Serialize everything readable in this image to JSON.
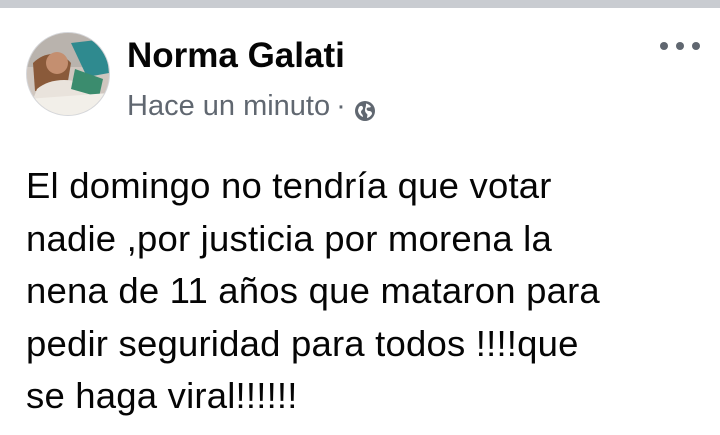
{
  "post": {
    "author_name": "Norma Galati",
    "timestamp": "Hace un minuto",
    "separator": "·",
    "privacy_icon": "globe-icon",
    "more_icon": "more-options-icon",
    "text_lines": [
      "El domingo no tendría que votar",
      "nadie ,por justicia por morena la",
      "nena de 11 años que mataron para",
      "pedir seguridad para todos !!!!que",
      "se haga viral!!!!!!"
    ]
  },
  "colors": {
    "text_primary": "#050505",
    "text_secondary": "#606770",
    "top_strip": "#c9ccd1"
  }
}
